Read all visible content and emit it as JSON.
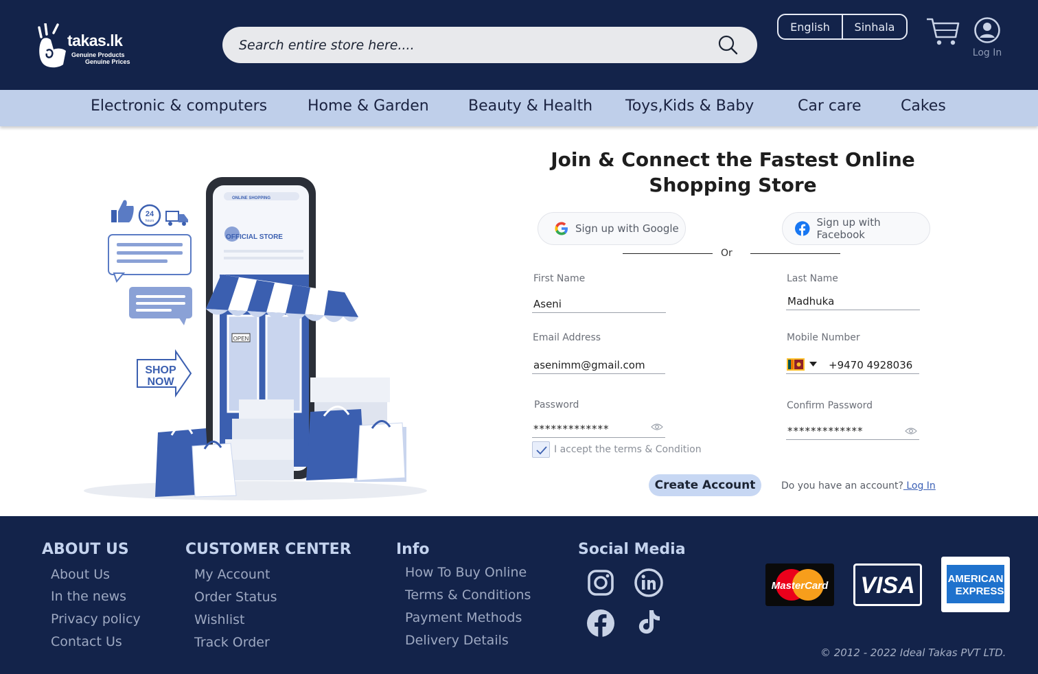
{
  "header": {
    "brand": "takas.lk",
    "tagline1": "Genuine Products",
    "tagline2": "Genuine Prices",
    "search_placeholder": "Search entire store here....",
    "languages": [
      "English",
      "Sinhala"
    ],
    "login_label": "Log In"
  },
  "categories": [
    "Electronic & computers",
    "Home & Garden",
    "Beauty & Health",
    "Toys,Kids & Baby",
    "Car care",
    "Cakes"
  ],
  "illustration": {
    "phone_search": "ONLINE SHOPPING",
    "store_label": "OFFICIAL STORE",
    "open_sign": "OPEN",
    "shop_now1": "SHOP",
    "shop_now2": "NOW",
    "hours": "24",
    "hours_sub": "hours"
  },
  "form": {
    "headline": "Join & Connect the Fastest Online Shopping Store",
    "google_label": "Sign up with Google",
    "facebook_label": "Sign up with Facebook",
    "or_label": "Or",
    "first_name_label": "First Name",
    "first_name_value": "Aseni",
    "last_name_label": "Last Name",
    "last_name_value": "Madhuka",
    "email_label": "Email Address",
    "email_value": "asenimm@gmail.com",
    "mobile_label": "Mobile Number",
    "mobile_value": "+9470 4928036",
    "password_label": "Password",
    "password_value": "*************",
    "confirm_label": "Confirm Password",
    "confirm_value": "*************",
    "terms_label": "I accept the terms & Condition",
    "terms_checked": true,
    "create_label": "Create Account",
    "have_account": "Do you have an account?",
    "login_link": " Log In"
  },
  "footer": {
    "about": {
      "heading": "ABOUT US",
      "links": [
        "About Us",
        "In the news",
        "Privacy policy",
        "Contact Us"
      ]
    },
    "customer": {
      "heading": "CUSTOMER CENTER",
      "links": [
        "My Account",
        "Order Status",
        "Wishlist",
        "Track Order"
      ]
    },
    "info": {
      "heading": "Info",
      "links": [
        "How To Buy Online",
        "Terms & Conditions",
        "Payment Methods",
        "Delivery Details"
      ]
    },
    "social": {
      "heading": "Social Media",
      "icons": [
        "instagram-icon",
        "linkedin-icon",
        "facebook-icon",
        "tiktok-icon"
      ]
    },
    "cards": {
      "mastercard": "MasterCard",
      "visa": "VISA",
      "amex1": "AMERICAN",
      "amex2": "EXPRESS"
    },
    "copyright": "© 2012 - 2022 Ideal Takas PVT LTD."
  },
  "colors": {
    "navy": "#13234a",
    "category_bar": "#bfcfea",
    "accent_blue": "#3b5fb0"
  }
}
